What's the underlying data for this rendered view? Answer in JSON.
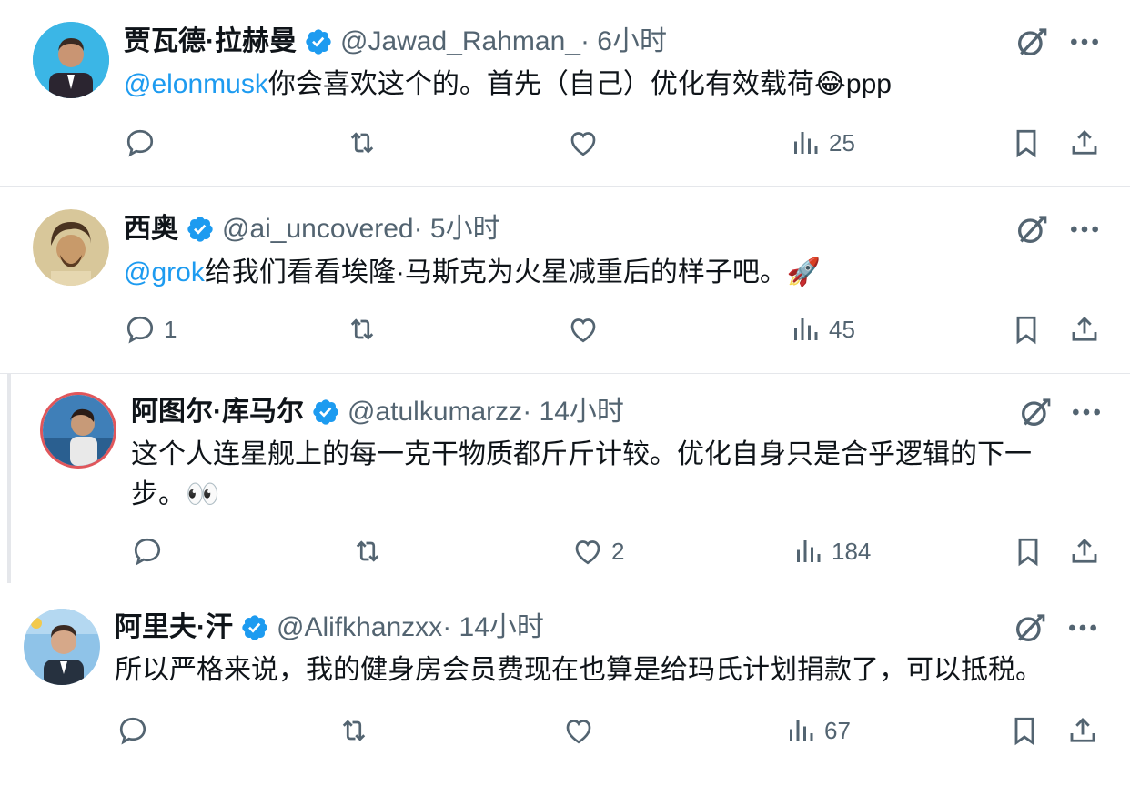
{
  "tweets": [
    {
      "display_name": "贾瓦德·拉赫曼",
      "handle": "@Jawad_Rahman_",
      "time": " · 6小时",
      "mention": "@elonmusk",
      "text": "你会喜欢这个的。首先（自己）优化有效载荷😂ppp",
      "text2": "",
      "replies": "",
      "retweets": "",
      "likes": "",
      "views": "25"
    },
    {
      "display_name": "西奥",
      "handle": "@ai_uncovered",
      "time": " · 5小时",
      "mention": "@grok",
      "text": "给我们看看埃隆·马斯克为火星减重后的样子吧。🚀",
      "text2": "",
      "replies": "1",
      "retweets": "",
      "likes": "",
      "views": "45"
    },
    {
      "display_name": "阿图尔·库马尔",
      "handle": "@atulkumarzz",
      "time": " · 14小时",
      "mention": "",
      "text": "这个人连星舰上的每一克干物质都斤斤计较。优化自身只是合乎逻辑的下一",
      "text2": "步。👀",
      "replies": "",
      "retweets": "",
      "likes": "2",
      "views": "184"
    },
    {
      "display_name": "阿里夫·汗",
      "handle": "@Alifkhanzxx",
      "time": " · 14小时",
      "mention": "",
      "text": "所以严格来说，我的健身房会员费现在也算是给玛氏计划捐款了，可以抵税。",
      "text2": "",
      "replies": "",
      "retweets": "",
      "likes": "",
      "views": "67"
    }
  ],
  "colors": {
    "accent": "#1d9bf0",
    "muted": "#536471",
    "text": "#0f1419",
    "border": "#e5e7eb"
  },
  "icons": [
    "verified-badge-icon",
    "grok-icon",
    "more-icon",
    "reply-icon",
    "retweet-icon",
    "like-icon",
    "views-icon",
    "bookmark-icon",
    "share-icon"
  ]
}
